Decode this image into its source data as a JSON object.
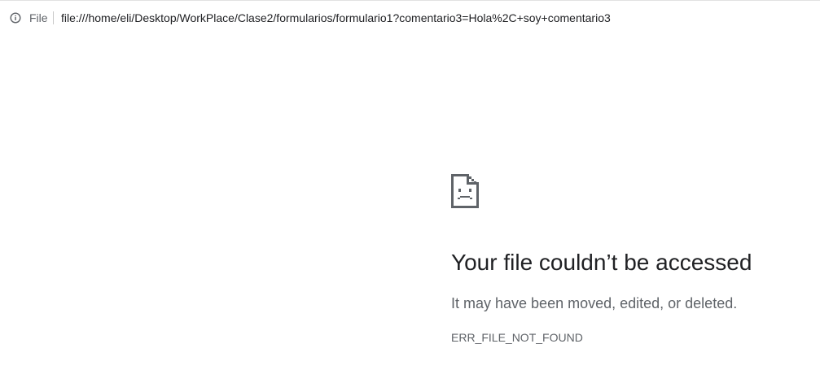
{
  "address_bar": {
    "info_icon": "info-circle-icon",
    "scheme_label": "File",
    "url": "file:///home/eli/Desktop/WorkPlace/Clase2/formularios/formulario1?comentario3=Hola%2C+soy+comentario3"
  },
  "error_page": {
    "icon": "sad-file-icon",
    "title": "Your file couldn’t be accessed",
    "description": "It may have been moved, edited, or deleted.",
    "error_code": "ERR_FILE_NOT_FOUND"
  },
  "colors": {
    "title_text": "#202124",
    "secondary_text": "#5f6368",
    "icon": "#5f6368"
  }
}
